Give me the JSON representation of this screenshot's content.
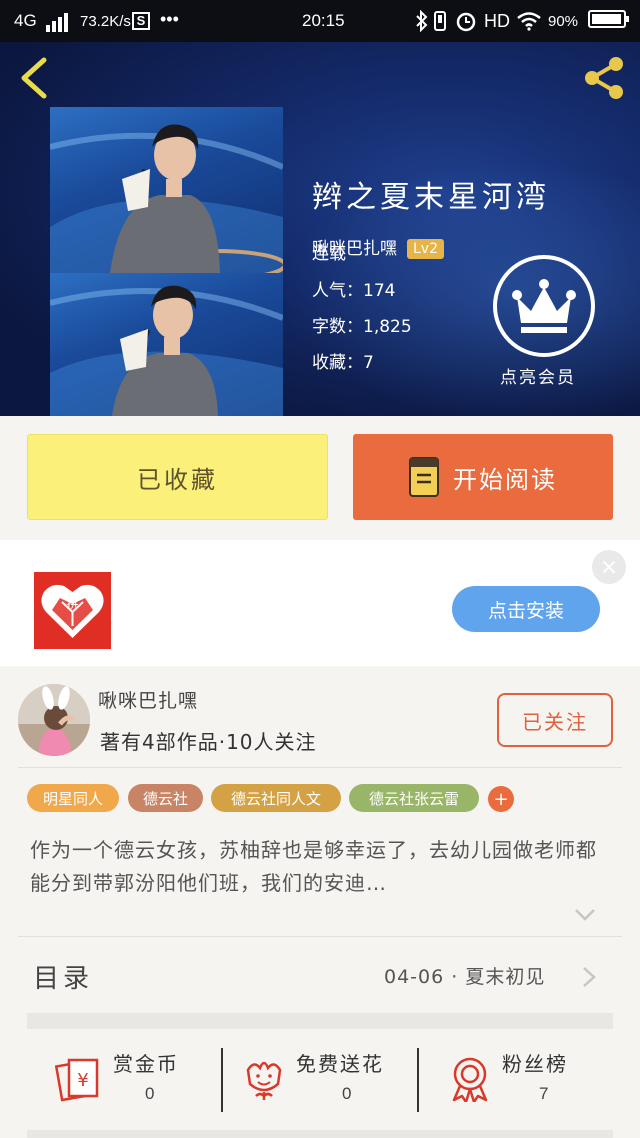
{
  "status_bar": {
    "network": "4G",
    "speed": "73.2K/s",
    "s_badge": "S",
    "dots": "•••",
    "time": "20:15",
    "hd": "HD",
    "battery": "90%"
  },
  "header": {
    "book_title": "辫之夏末星河湾",
    "author": "啾咪巴扎嘿",
    "level": "Lv2",
    "status": "连载",
    "popularity_label": "人气：",
    "popularity": "174",
    "words_label": "字数：",
    "words": "1,825",
    "favorites_label": "收藏：",
    "favorites": "7",
    "vip_label": "点亮会员"
  },
  "actions": {
    "collected_label": "已收藏",
    "read_label": "开始阅读"
  },
  "ad": {
    "install_label": "点击安装",
    "close_label": "×",
    "logo_text": "拼"
  },
  "author": {
    "name": "啾咪巴扎嘿",
    "stats": "著有4部作品·10人关注",
    "follow_label": "已关注"
  },
  "tags": [
    {
      "label": "明星同人",
      "color": "#f0a84a"
    },
    {
      "label": "德云社",
      "color": "#c98466"
    },
    {
      "label": "德云社同人文",
      "color": "#d4a245"
    },
    {
      "label": "德云社张云雷",
      "color": "#99b567"
    }
  ],
  "tag_more": "+",
  "synopsis": "作为一个德云女孩，苏柚辞也是够幸运了，去幼儿园做老师都能分到带郭汾阳他们班，我们的安迪…",
  "toc": {
    "label": "目录",
    "latest": "04-06 · 夏末初见"
  },
  "bottom": {
    "coins_label": "赏金币",
    "coins": "0",
    "flowers_label": "免费送花",
    "flowers": "0",
    "fans_label": "粉丝榜",
    "fans": "7"
  },
  "colors": {
    "accent_orange": "#ea6b3d",
    "collected_yellow": "#fbf17a",
    "install_blue": "#5fa4ec",
    "level_gold": "#e7b447"
  }
}
